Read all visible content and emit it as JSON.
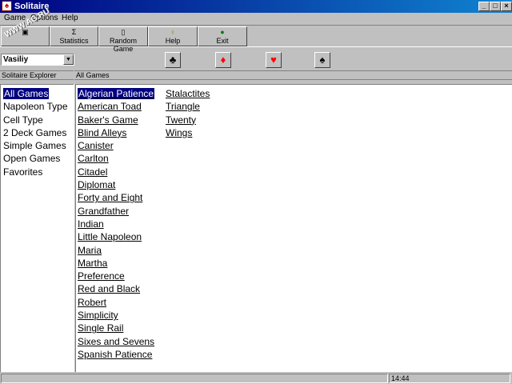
{
  "window": {
    "title": "Solitaire",
    "controls": {
      "minimize": "_",
      "maximize": "□",
      "close": "×"
    }
  },
  "menu": [
    "Game",
    "Options",
    "Help"
  ],
  "toolbar": [
    {
      "label": "",
      "icon": "open-icon",
      "glyph": "▣"
    },
    {
      "label": "Statistics",
      "icon": "sigma-icon",
      "glyph": "Σ"
    },
    {
      "label": "Random Game",
      "icon": "document-icon",
      "glyph": "▯"
    },
    {
      "label": "Help",
      "icon": "lightbulb-icon",
      "glyph": "♀"
    },
    {
      "label": "Exit",
      "icon": "exit-icon",
      "glyph": "●"
    }
  ],
  "player": {
    "selected": "Vasiliy"
  },
  "suits": [
    {
      "name": "clubs",
      "glyph": "♣",
      "color": "#000000"
    },
    {
      "name": "diamonds",
      "glyph": "♦",
      "color": "#ff0000"
    },
    {
      "name": "hearts",
      "glyph": "♥",
      "color": "#ff0000"
    },
    {
      "name": "spades",
      "glyph": "♠",
      "color": "#000000"
    }
  ],
  "explorer": {
    "header": "Solitaire Explorer",
    "items": [
      "All Games",
      "Napoleon Type",
      "Cell Type",
      "2 Deck Games",
      "Simple Games",
      "Open Games",
      "Favorites"
    ],
    "selected": "All Games"
  },
  "games": {
    "header": "All Games",
    "column1": [
      "Algerian Patience",
      "American Toad",
      "Baker's Game",
      "Blind Alleys",
      "Canister",
      "Carlton",
      "Citadel",
      "Diplomat",
      "Forty and Eight",
      "Grandfather",
      "Indian",
      "Little Napoleon",
      "Maria",
      "Martha",
      "Preference",
      "Red and Black",
      "Robert",
      "Simplicity",
      "Single Rail",
      "Sixes and Sevens",
      "Spanish Patience"
    ],
    "column2": [
      "Stalactites",
      "Triangle",
      "Twenty",
      "Wings"
    ],
    "selected": "Algerian Patience"
  },
  "status": {
    "message": "",
    "time": "14:44"
  },
  "watermark": "WWW.AG.RU",
  "colors": {
    "titlebar": "#000080",
    "selection": "#000080",
    "face": "#c0c0c0"
  }
}
